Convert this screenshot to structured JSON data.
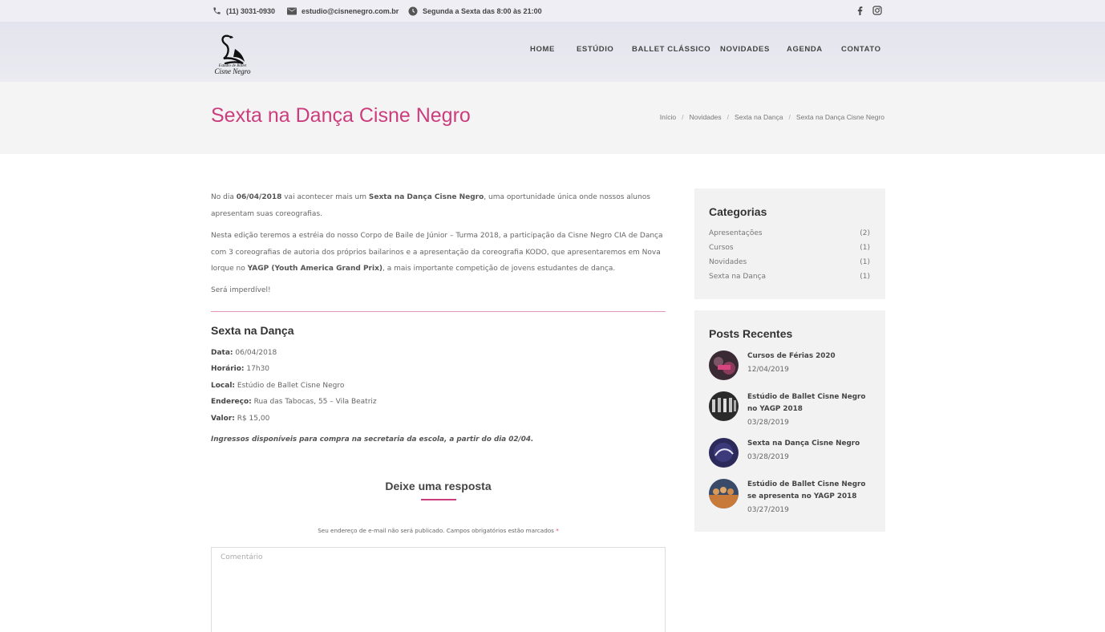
{
  "topbar": {
    "phone": "(11) 3031-0930",
    "email": "estudio@cisnenegro.com.br",
    "hours": "Segunda a Sexta das 8:00 às 21:00",
    "social": [
      "facebook-icon",
      "instagram-icon"
    ]
  },
  "logo": {
    "line1": "Estúdio de Ballet",
    "line2": "Cisne Negro"
  },
  "nav": {
    "items": [
      "HOME",
      "ESTÚDIO",
      "BALLET CLÁSSICO",
      "NOVIDADES",
      "AGENDA",
      "CONTATO"
    ]
  },
  "page": {
    "title": "Sexta na Dança Cisne Negro",
    "breadcrumb": [
      "Início",
      "Novidades",
      "Sexta na Dança",
      "Sexta na Dança Cisne Negro"
    ]
  },
  "article": {
    "p1": {
      "a": "No dia ",
      "b": "06/04/2018",
      "c": " vai acontecer mais um ",
      "d": "Sexta na Dança Cisne Negro",
      "e": ", uma oportunidade única onde nossos alunos apresentam suas coreografias."
    },
    "p2": {
      "a": "Nesta edição teremos a estréia do nosso Corpo de Baile de Júnior – Turma 2018, a participação da Cisne Negro CIA de Dança com 3 coreografias de autoria dos próprios bailarinos e a apresentação da coreografia KODO, que apresentaremos em Nova Iorque no ",
      "b": "YAGP (Youth America Grand Prix)",
      "c": ", a mais importante competição de jovens estudantes de dança."
    },
    "p3": "Será imperdível!",
    "event_title": "Sexta na Dança",
    "event": [
      {
        "label": "Data:",
        "value": " 06/04/2018"
      },
      {
        "label": "Horário:",
        "value": " 17h30"
      },
      {
        "label": "Local:",
        "value": " Estúdio de Ballet Cisne Negro"
      },
      {
        "label": "Endereço:",
        "value": " Rua das Tabocas, 55 – Vila Beatriz"
      },
      {
        "label": "Valor:",
        "value": " R$ 15,00"
      }
    ],
    "tickets": "Ingressos disponíveis para compra na secretaria da escola, a partir do dia 02/04."
  },
  "reply": {
    "title": "Deixe uma resposta",
    "note": "Seu endereço de e-mail não será publicado. Campos obrigatórios estão marcados ",
    "required_mark": "*",
    "comment_placeholder": "Comentário"
  },
  "sidebar": {
    "categories_title": "Categorias",
    "categories": [
      {
        "name": "Apresentações",
        "count": "(2)"
      },
      {
        "name": "Cursos",
        "count": "(1)"
      },
      {
        "name": "Novidades",
        "count": "(1)"
      },
      {
        "name": "Sexta na Dança",
        "count": "(1)"
      }
    ],
    "recent_title": "Posts Recentes",
    "recent": [
      {
        "title": "Cursos de Férias 2020",
        "date": "12/04/2019"
      },
      {
        "title": "Estúdio de Ballet Cisne Negro no YAGP 2018",
        "date": "03/28/2019"
      },
      {
        "title": "Sexta na Dança Cisne Negro",
        "date": "03/28/2019"
      },
      {
        "title": "Estúdio de Ballet Cisne Negro se apresenta no YAGP 2018",
        "date": "03/27/2019"
      }
    ]
  },
  "colors": {
    "accent": "#cc3d7e",
    "topbar_bg": "#eeeef4",
    "header_bg": "#e6e6ee",
    "title_band_bg": "#f4f4f4",
    "sidebar_bg": "#f2f2f2"
  }
}
